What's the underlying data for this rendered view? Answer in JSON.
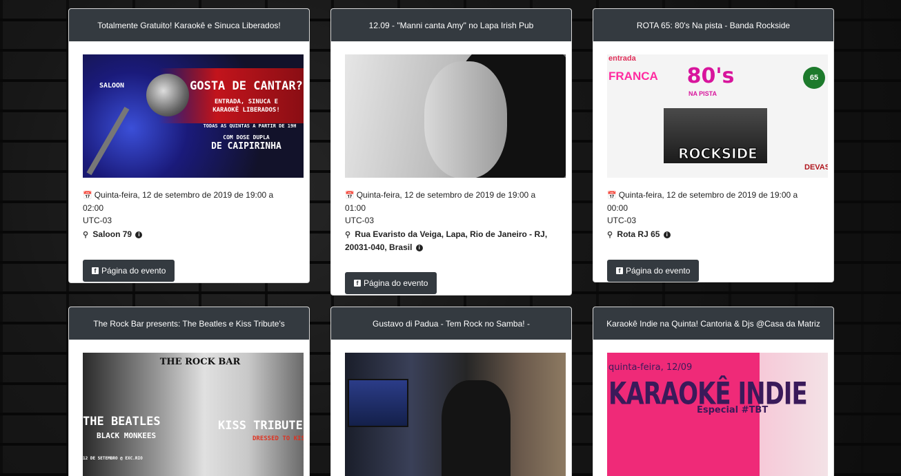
{
  "icons": {
    "calendar": "calendar-icon",
    "map_marker": "map-marker-icon",
    "info": "info-circle-icon",
    "facebook": "facebook-icon"
  },
  "events": [
    {
      "title": "Totalmente Gratuito! Karaokê e Sinuca Liberados!",
      "date": "Quinta-feira, 12 de setembro de 2019 de 19:00 a 02:00",
      "tz": "UTC-03",
      "venue": "Saloon 79",
      "button": "Página do evento",
      "image_text": {
        "logo": "SALOON",
        "headline": "GOSTA DE CANTAR?",
        "line1": "ENTRADA, SINUCA E",
        "line2": "KARAOKÊ LIBERADOS!",
        "line3": "TODAS AS QUINTAS A PARTIR DE 19H",
        "line4": "COM DOSE DUPLA",
        "line5": "DE CAIPIRINHA"
      }
    },
    {
      "title": "12.09 - \"Manni canta Amy\" no Lapa Irish Pub",
      "date": "Quinta-feira, 12 de setembro de 2019 de 19:00 a 01:00",
      "tz": "UTC-03",
      "venue": "Rua Evaristo da Veiga, Lapa, Rio de Janeiro - RJ, 20031-040, Brasil",
      "button": "Página do evento"
    },
    {
      "title": "ROTA 65: 80's Na pista - Banda Rockside",
      "date": "Quinta-feira, 12 de setembro de 2019 de 19:00 a 00:00",
      "tz": "UTC-03",
      "venue": "Rota RJ 65",
      "button": "Página do evento",
      "image_text": {
        "entrada": "entrada",
        "franca": "FRANCA",
        "eighties": "80's",
        "na_pista": "NA PISTA",
        "band": "ROCKSIDE",
        "badge": "65",
        "devassa": "DEVASS"
      }
    },
    {
      "title": "The Rock Bar presents: The Beatles e Kiss Tribute's",
      "image_text": {
        "logo": "THE ROCK BAR",
        "beatles": "THE BEATLES",
        "monkees": "BLACK MONKEES",
        "kiss": "KISS TRIBUTE",
        "dressed": "DRESSED TO KISS",
        "date": "12 DE SETEMBRO @ EXC.RIO"
      }
    },
    {
      "title": "Gustavo di Padua - Tem Rock no Samba! -"
    },
    {
      "title": "Karaokê Indie na Quinta! Cantoria & Djs @Casa da Matriz",
      "image_text": {
        "day": "quinta-feira, 12/09",
        "headline": "KARAOKÊ INDIE",
        "sub": "Especial #TBT"
      }
    }
  ]
}
